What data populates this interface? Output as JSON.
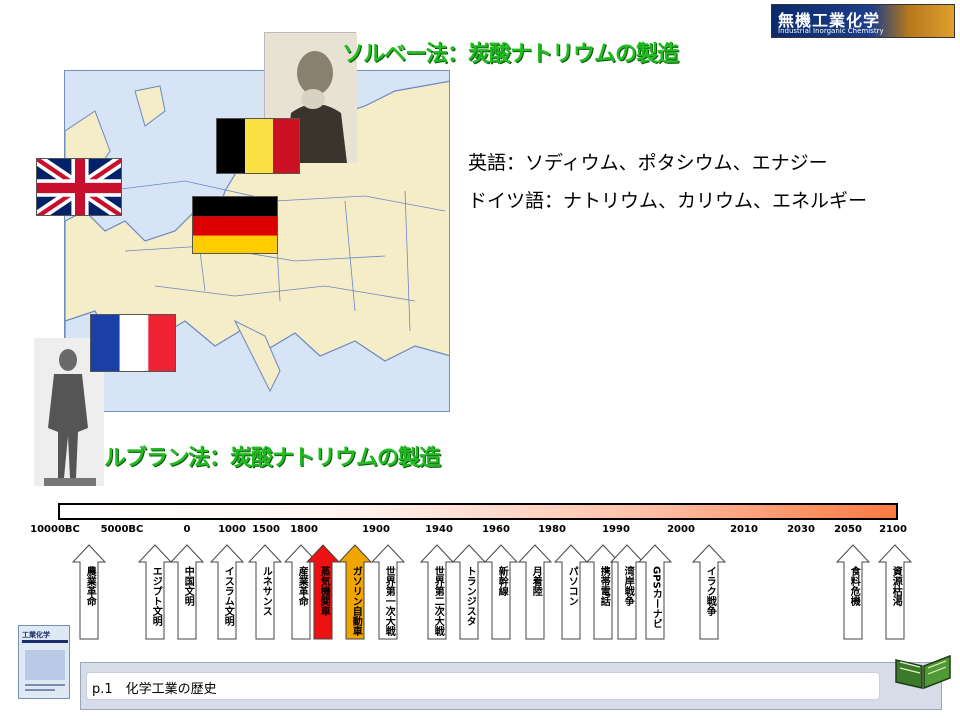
{
  "logo": {
    "title": "無機工業化学",
    "subtitle": "Industrial Inorganic Chemistry"
  },
  "titles": {
    "solvay": "ソルベー法：炭酸ナトリウムの製造",
    "leblanc": "ルブラン法：炭酸ナトリウムの製造"
  },
  "languages": {
    "english": "英語：ソディウム、ポタシウム、エナジー",
    "german": "ドイツ語：ナトリウム、カリウム、エネルギー"
  },
  "timeline": {
    "ticks": [
      "10000BC",
      "5000BC",
      "0",
      "1000",
      "1500",
      "1800",
      "1900",
      "1940",
      "1960",
      "1980",
      "1990",
      "2000",
      "2010",
      "2030",
      "2050",
      "2100"
    ],
    "events": [
      {
        "label": "農業革命",
        "color": "#ffffff"
      },
      {
        "label": "エジプト文明",
        "color": "#ffffff"
      },
      {
        "label": "中国文明",
        "color": "#ffffff"
      },
      {
        "label": "イスラム文明",
        "color": "#ffffff"
      },
      {
        "label": "ルネサンス",
        "color": "#ffffff"
      },
      {
        "label": "産業革命",
        "color": "#ffffff"
      },
      {
        "label": "蒸気機関車",
        "color": "#ee1111"
      },
      {
        "label": "ガソリン自動車",
        "color": "#f0a500"
      },
      {
        "label": "世界第一次大戦",
        "color": "#ffffff"
      },
      {
        "label": "世界第二次大戦",
        "color": "#ffffff"
      },
      {
        "label": "トランジスタ",
        "color": "#ffffff"
      },
      {
        "label": "新幹線",
        "color": "#ffffff"
      },
      {
        "label": "月着陸",
        "color": "#ffffff"
      },
      {
        "label": "パソコン",
        "color": "#ffffff"
      },
      {
        "label": "携帯電話",
        "color": "#ffffff"
      },
      {
        "label": "湾岸戦争",
        "color": "#ffffff"
      },
      {
        "label": "GPSカーナビ",
        "color": "#ffffff"
      },
      {
        "label": "イラク戦争",
        "color": "#ffffff"
      },
      {
        "label": "食料危機",
        "color": "#ffffff"
      },
      {
        "label": "資源枯渇",
        "color": "#ffffff"
      }
    ]
  },
  "book": {
    "title": "工業化学"
  },
  "footer": {
    "text": "p.1　化学工業の歴史"
  },
  "colors": {
    "title_green": "#22bb22",
    "map_sea": "#d6e4f6",
    "map_land": "#f5edc8",
    "highlight_red": "#ee1111",
    "highlight_orange": "#f0a500"
  }
}
